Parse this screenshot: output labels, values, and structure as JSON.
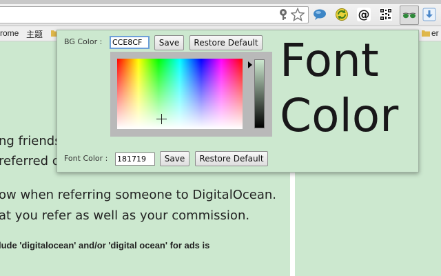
{
  "bookmarks": {
    "items": [
      {
        "label": "rome"
      },
      {
        "label": "主题"
      }
    ],
    "right_label": "er b"
  },
  "page": {
    "lines": [
      "ng friends",
      "referred c",
      "ow when referring someone to DigitalOcean.",
      "at you refer as well as your commission.",
      "lude 'digitalocean' and/or 'digital ocean' for ads is"
    ]
  },
  "popup": {
    "bg": {
      "label": "BG Color :",
      "value": "CCE8CF",
      "save_label": "Save",
      "restore_label": "Restore Default"
    },
    "font": {
      "label": "Font Color :",
      "value": "181719",
      "save_label": "Save",
      "restore_label": "Restore Default"
    },
    "preview_line1": "Font",
    "preview_line2": "Color"
  },
  "colors": {
    "bg": "#cce8cf",
    "font": "#181719"
  },
  "icons": [
    "key-icon",
    "star-icon",
    "speech-bubble-icon",
    "refresh-icon",
    "at-icon",
    "qr-code-icon",
    "sunglasses-icon",
    "download-icon"
  ]
}
